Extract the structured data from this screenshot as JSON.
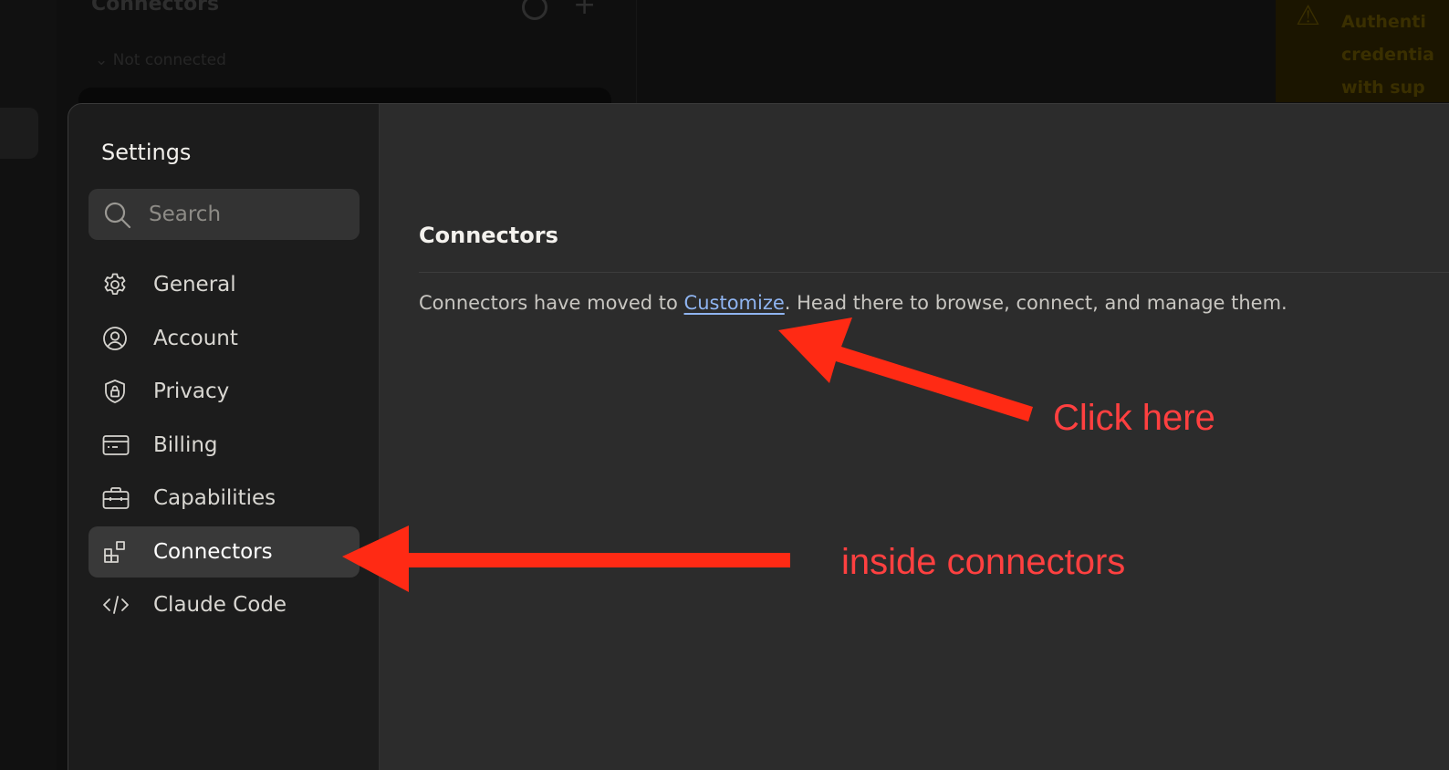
{
  "background": {
    "panel_title": "Connectors",
    "panel_subtitle": "Not connected",
    "warning_text": "Authenti credentia with sup"
  },
  "settings": {
    "title": "Settings",
    "search": {
      "placeholder": "Search",
      "value": ""
    },
    "nav": [
      {
        "label": "General",
        "icon": "gear-icon",
        "active": false
      },
      {
        "label": "Account",
        "icon": "account-icon",
        "active": false
      },
      {
        "label": "Privacy",
        "icon": "shield-lock-icon",
        "active": false
      },
      {
        "label": "Billing",
        "icon": "credit-card-icon",
        "active": false
      },
      {
        "label": "Capabilities",
        "icon": "briefcase-icon",
        "active": false
      },
      {
        "label": "Connectors",
        "icon": "connectors-icon",
        "active": true
      },
      {
        "label": "Claude Code",
        "icon": "code-icon",
        "active": false
      }
    ]
  },
  "content": {
    "section_title": "Connectors",
    "message_before": "Connectors have moved to ",
    "message_link": "Customize",
    "message_after": ". Head there to browse, connect, and manage them."
  },
  "annotations": {
    "click_here": "Click here",
    "inside_connectors": "inside connectors",
    "color": "#ff2a14",
    "text_color": "#ff4040"
  },
  "colors": {
    "accent_link": "#8fb4f0",
    "sidebar_bg": "#1c1c1c",
    "content_bg": "#2c2c2c",
    "active_item_bg": "#393939"
  }
}
